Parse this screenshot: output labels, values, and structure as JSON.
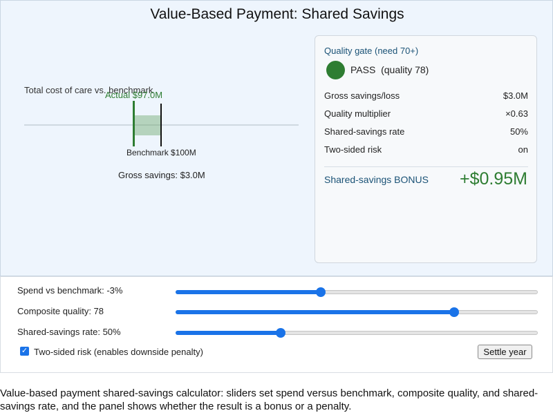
{
  "app": {
    "title": "Value-Based Payment: Shared Savings"
  },
  "chart": {
    "label": "Total cost of care vs. benchmark",
    "actual_label": "Actual $97.0M",
    "benchmark_label": "Benchmark $100M",
    "gross_label": "Gross savings: $3.0M",
    "actual_color": "#2e7d32",
    "benchmark_color": "#111111"
  },
  "panel": {
    "gate_title": "Quality gate (need 70+)",
    "status": "PASS  (quality 78)",
    "status_color": "#2e7d32",
    "rows": [
      {
        "label": "Gross savings/loss",
        "value": "$3.0M"
      },
      {
        "label": "Quality multiplier",
        "value": "×0.63"
      },
      {
        "label": "Shared-savings rate",
        "value": "50%"
      },
      {
        "label": "Two-sided risk",
        "value": "on"
      }
    ],
    "bonus_label": "Shared-savings BONUS",
    "bonus_value": "+$0.95M"
  },
  "controls": {
    "sliders": [
      {
        "label": "Spend vs benchmark: -3%",
        "fraction": 0.4
      },
      {
        "label": "Composite quality: 78",
        "fraction": 0.77
      },
      {
        "label": "Shared-savings rate: 50%",
        "fraction": 0.29
      }
    ],
    "two_sided_label": "Two-sided risk (enables downside penalty)",
    "two_sided_checked": true,
    "settle_button": "Settle year"
  },
  "caption": "Value-based payment shared-savings calculator: sliders set spend versus benchmark, composite quality, and shared-savings rate, and the panel shows whether the result is a bonus or a penalty."
}
